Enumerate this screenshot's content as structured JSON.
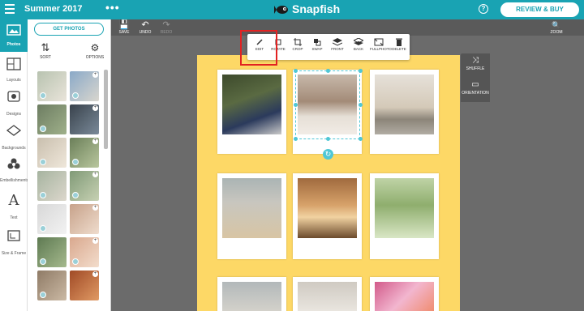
{
  "topbar": {
    "title": "Summer 2017",
    "more": "•••",
    "logo": "Snapfish",
    "help": "?",
    "review_label": "REVIEW & BUY"
  },
  "rail": [
    {
      "label": "Photos",
      "icon": "photos-icon",
      "active": true
    },
    {
      "label": "Layouts",
      "icon": "layouts-icon"
    },
    {
      "label": "Designs",
      "icon": "designs-icon"
    },
    {
      "label": "Backgrounds",
      "icon": "backgrounds-icon"
    },
    {
      "label": "Embellishments",
      "icon": "embellishments-icon"
    },
    {
      "label": "Text",
      "icon": "text-icon"
    },
    {
      "label": "Size & Frame",
      "icon": "size-frame-icon"
    }
  ],
  "panel": {
    "get_photos": "GET PHOTOS",
    "sort_label": "SORT",
    "options_label": "OPTIONS"
  },
  "toolstrip": {
    "save": "SAVE",
    "undo": "UNDO",
    "redo": "REDO",
    "zoom": "ZOOM"
  },
  "context_toolbar": [
    "EDIT",
    "ROTATE",
    "CROP",
    "SWAP",
    "FRONT",
    "BACK",
    "FULLPHOTO",
    "DELETE"
  ],
  "side_tools": {
    "shuffle": "SHUFFLE",
    "orientation": "ORIENTATION"
  },
  "colors": {
    "accent": "#19a3b3",
    "page": "#fdd866",
    "selection": "#4fc7d6",
    "highlight": "#e22222"
  }
}
